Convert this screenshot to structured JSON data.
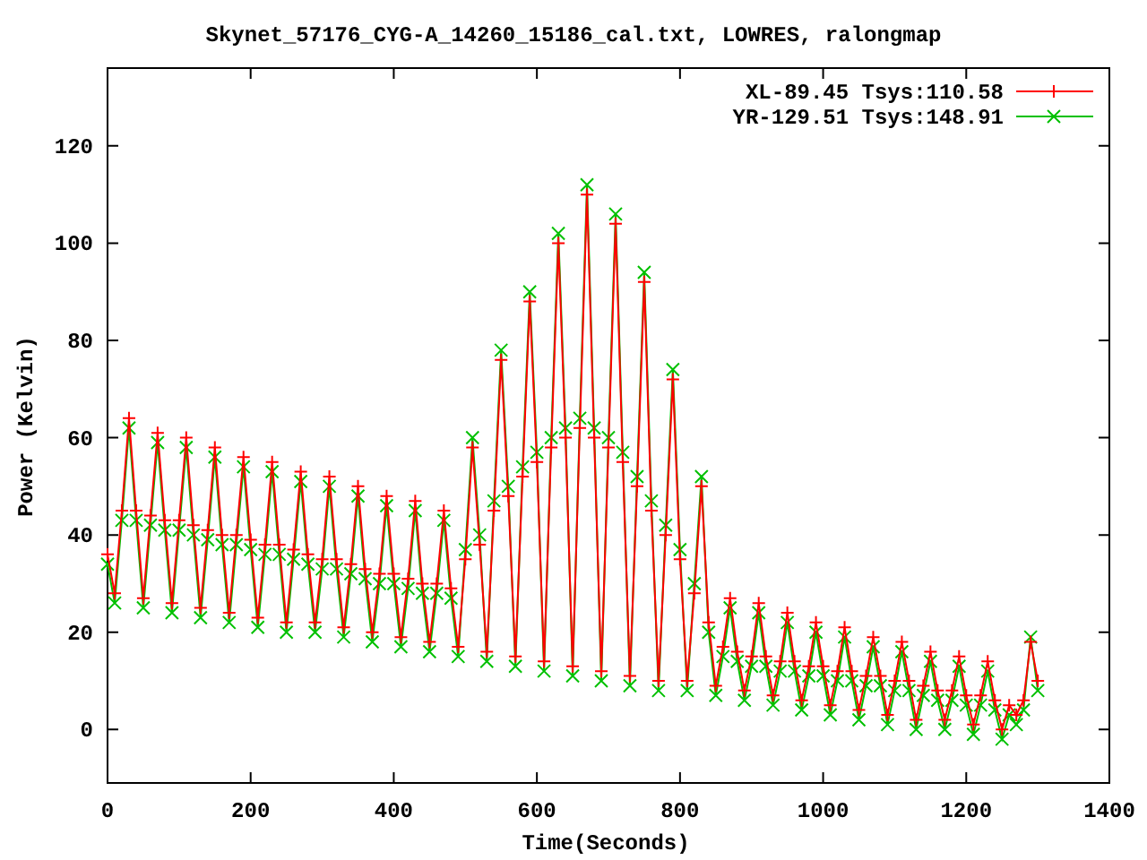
{
  "plot": {
    "chart_data": {
      "type": "line",
      "title": "Skynet_57176_CYG-A_14260_15186_cal.txt, LOWRES, ralongmap",
      "xlabel": "Time(Seconds)",
      "ylabel": "Power (Kelvin)",
      "xlim": [
        0,
        1400
      ],
      "ylim": [
        -11,
        136
      ],
      "xticks": [
        0,
        200,
        400,
        600,
        800,
        1000,
        1200,
        1400
      ],
      "yticks": [
        0,
        20,
        40,
        60,
        80,
        100,
        120
      ],
      "x": [
        0,
        10,
        20,
        30,
        40,
        50,
        60,
        70,
        80,
        90,
        100,
        110,
        120,
        130,
        140,
        150,
        160,
        170,
        180,
        190,
        200,
        210,
        220,
        230,
        240,
        250,
        260,
        270,
        280,
        290,
        300,
        310,
        320,
        330,
        340,
        350,
        360,
        370,
        380,
        390,
        400,
        410,
        420,
        430,
        440,
        450,
        460,
        470,
        480,
        490,
        500,
        510,
        520,
        530,
        540,
        550,
        560,
        570,
        580,
        590,
        600,
        610,
        620,
        630,
        640,
        650,
        660,
        670,
        680,
        690,
        700,
        710,
        720,
        730,
        740,
        750,
        760,
        770,
        780,
        790,
        800,
        810,
        820,
        830,
        840,
        850,
        860,
        870,
        880,
        890,
        900,
        910,
        920,
        930,
        940,
        950,
        960,
        970,
        980,
        990,
        1000,
        1010,
        1020,
        1030,
        1040,
        1050,
        1060,
        1070,
        1080,
        1090,
        1100,
        1110,
        1120,
        1130,
        1140,
        1150,
        1160,
        1170,
        1180,
        1190,
        1200,
        1210,
        1220,
        1230,
        1240,
        1250,
        1260,
        1270,
        1280,
        1290,
        1300
      ],
      "legend": "top right",
      "series": [
        {
          "name": "XL-89.45 Tsys:110.58",
          "color": "#ff0000",
          "marker": "plus",
          "values": [
            36,
            28,
            45,
            64,
            45,
            27,
            44,
            61,
            43,
            26,
            43,
            60,
            42,
            25,
            41,
            58,
            40,
            24,
            40,
            56,
            39,
            23,
            38,
            55,
            38,
            22,
            37,
            53,
            36,
            22,
            35,
            52,
            35,
            21,
            34,
            50,
            33,
            20,
            32,
            48,
            32,
            19,
            31,
            47,
            30,
            18,
            30,
            45,
            29,
            17,
            35,
            58,
            38,
            16,
            45,
            76,
            48,
            15,
            52,
            88,
            55,
            14,
            58,
            100,
            60,
            13,
            62,
            110,
            60,
            12,
            58,
            104,
            55,
            11,
            50,
            92,
            45,
            10,
            40,
            72,
            35,
            10,
            28,
            50,
            22,
            9,
            17,
            27,
            16,
            8,
            15,
            26,
            15,
            7,
            14,
            24,
            14,
            6,
            13,
            22,
            13,
            5,
            12,
            21,
            12,
            4,
            11,
            19,
            11,
            3,
            10,
            18,
            10,
            2,
            9,
            16,
            8,
            2,
            8,
            15,
            7,
            1,
            7,
            14,
            6,
            0,
            5,
            3,
            6,
            18,
            10
          ]
        },
        {
          "name": "YR-129.51 Tsys:148.91",
          "color": "#00c000",
          "marker": "cross",
          "values": [
            34,
            26,
            43,
            62,
            43,
            25,
            42,
            59,
            41,
            24,
            41,
            58,
            40,
            23,
            39,
            56,
            38,
            22,
            38,
            54,
            37,
            21,
            36,
            53,
            36,
            20,
            35,
            51,
            34,
            20,
            33,
            50,
            33,
            19,
            32,
            48,
            31,
            18,
            30,
            46,
            30,
            17,
            29,
            45,
            28,
            16,
            28,
            43,
            27,
            15,
            37,
            60,
            40,
            14,
            47,
            78,
            50,
            13,
            54,
            90,
            57,
            12,
            60,
            102,
            62,
            11,
            64,
            112,
            62,
            10,
            60,
            106,
            57,
            9,
            52,
            94,
            47,
            8,
            42,
            74,
            37,
            8,
            30,
            52,
            20,
            7,
            15,
            25,
            14,
            6,
            13,
            24,
            13,
            5,
            12,
            22,
            12,
            4,
            11,
            20,
            11,
            3,
            10,
            19,
            10,
            2,
            9,
            17,
            9,
            1,
            8,
            16,
            8,
            0,
            7,
            14,
            6,
            0,
            6,
            13,
            5,
            -1,
            5,
            12,
            4,
            -2,
            3,
            1,
            4,
            19,
            8
          ]
        }
      ]
    }
  }
}
